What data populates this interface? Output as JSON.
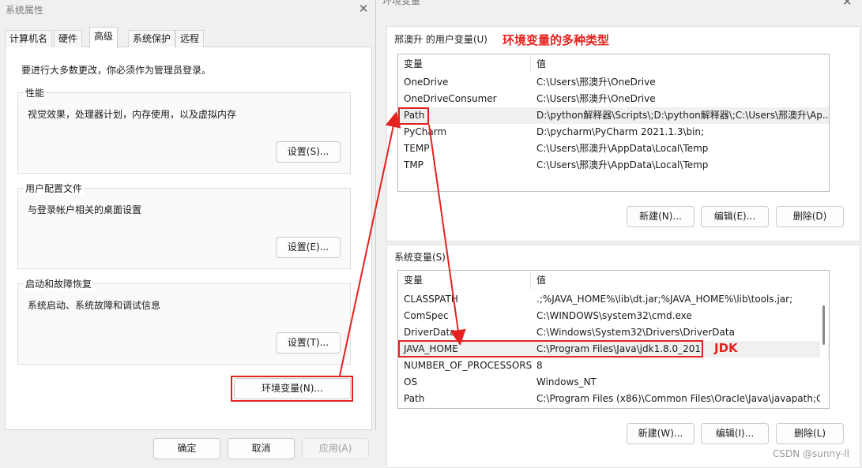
{
  "left_dialog": {
    "title": "系统属性",
    "close_glyph": "✕",
    "tabs": [
      "计算机名",
      "硬件",
      "高级",
      "系统保护",
      "远程"
    ],
    "active_tab": "高级",
    "note": "要进行大多数更改，你必须作为管理员登录。",
    "groups": [
      {
        "legend": "性能",
        "desc": "视觉效果，处理器计划，内存使用，以及虚拟内存",
        "button": "设置(S)..."
      },
      {
        "legend": "用户配置文件",
        "desc": "与登录帐户相关的桌面设置",
        "button": "设置(E)..."
      },
      {
        "legend": "启动和故障恢复",
        "desc": "系统启动、系统故障和调试信息",
        "button": "设置(T)..."
      }
    ],
    "env_button": "环境变量(N)...",
    "ok_button": "确定",
    "cancel_button": "取消",
    "apply_button": "应用(A)"
  },
  "right_dialog": {
    "title": "环境变量",
    "close_glyph": "✕",
    "user_section_label": "邢澳升 的用户变量(U)",
    "annotation_types": "环境变量的多种类型",
    "annotation_jdk": "JDK",
    "col_var": "变量",
    "col_val": "值",
    "user_vars": [
      {
        "name": "OneDrive",
        "value": "C:\\Users\\邢澳升\\OneDrive"
      },
      {
        "name": "OneDriveConsumer",
        "value": "C:\\Users\\邢澳升\\OneDrive"
      },
      {
        "name": "Path",
        "value": "D:\\python解释器\\Scripts\\;D:\\python解释器\\;C:\\Users\\邢澳升\\Ap..."
      },
      {
        "name": "PyCharm",
        "value": "D:\\pycharm\\PyCharm 2021.1.3\\bin;"
      },
      {
        "name": "TEMP",
        "value": "C:\\Users\\邢澳升\\AppData\\Local\\Temp"
      },
      {
        "name": "TMP",
        "value": "C:\\Users\\邢澳升\\AppData\\Local\\Temp"
      }
    ],
    "user_buttons": {
      "new": "新建(N)...",
      "edit": "编辑(E)...",
      "delete": "删除(D)"
    },
    "system_section_label": "系统变量(S)",
    "system_vars": [
      {
        "name": "CLASSPATH",
        "value": ".;%JAVA_HOME%\\lib\\dt.jar;%JAVA_HOME%\\lib\\tools.jar;"
      },
      {
        "name": "ComSpec",
        "value": "C:\\WINDOWS\\system32\\cmd.exe"
      },
      {
        "name": "DriverData",
        "value": "C:\\Windows\\System32\\Drivers\\DriverData"
      },
      {
        "name": "JAVA_HOME",
        "value": "C:\\Program Files\\Java\\jdk1.8.0_201"
      },
      {
        "name": "NUMBER_OF_PROCESSORS",
        "value": "8"
      },
      {
        "name": "OS",
        "value": "Windows_NT"
      },
      {
        "name": "Path",
        "value": "C:\\Program Files (x86)\\Common Files\\Oracle\\Java\\javapath;C:..."
      }
    ],
    "system_buttons": {
      "new": "新建(W)...",
      "edit": "编辑(I)...",
      "delete": "删除(L)"
    }
  },
  "watermark": "CSDN @sunny-ll",
  "colors": {
    "annotation_red": "#e5221f",
    "selected_row": "#f0f0f0"
  }
}
